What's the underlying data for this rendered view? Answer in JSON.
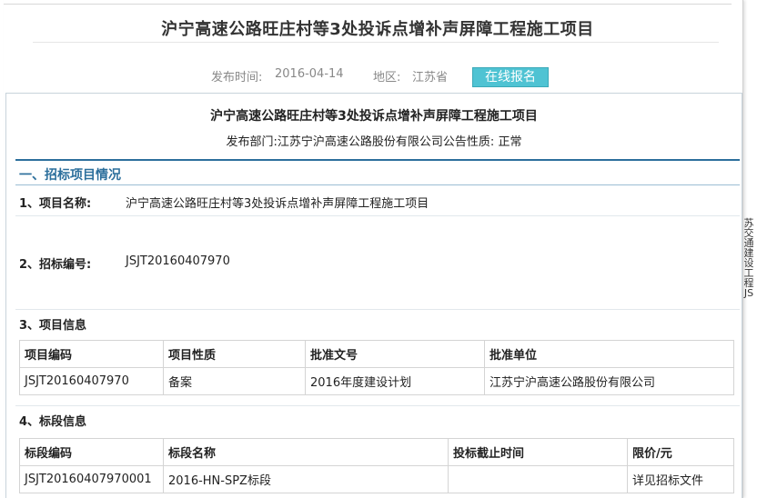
{
  "page": {
    "title": "沪宁高速公路旺庄村等3处投诉点增补声屏障工程施工项目",
    "publish_label": "发布时间:",
    "publish_date": "2016-04-14",
    "region_label": "地区:",
    "region": "江苏省",
    "signup_button": "在线报名"
  },
  "notice": {
    "title": "沪宁高速公路旺庄村等3处投诉点增补声屏障工程施工项目",
    "subline": "发布部门:江苏宁沪高速公路股份有限公司公告性质:  正常",
    "section1": "一、招标项目情况",
    "project_name_label": "1、项目名称:",
    "project_name": "沪宁高速公路旺庄村等3处投诉点增补声屏障工程施工项目",
    "tender_no_label": "2、招标编号:",
    "tender_no": "JSJT20160407970",
    "project_info_label": "3、项目信息",
    "project_table": {
      "headers": [
        "项目编码",
        "项目性质",
        "批准文号",
        "批准单位"
      ],
      "rows": [
        [
          "JSJT20160407970",
          "备案",
          "2016年度建设计划",
          "江苏宁沪高速公路股份有限公司"
        ]
      ]
    },
    "section_info_label": "4、标段信息",
    "section_table": {
      "headers": [
        "标段编码",
        "标段名称",
        "投标截止时间",
        "限价/元"
      ],
      "rows": [
        [
          "JSJT20160407970001",
          "2016-HN-SPZ标段",
          "",
          "详见招标文件"
        ]
      ]
    }
  },
  "sidebar_text": "苏交通建设工程JS"
}
